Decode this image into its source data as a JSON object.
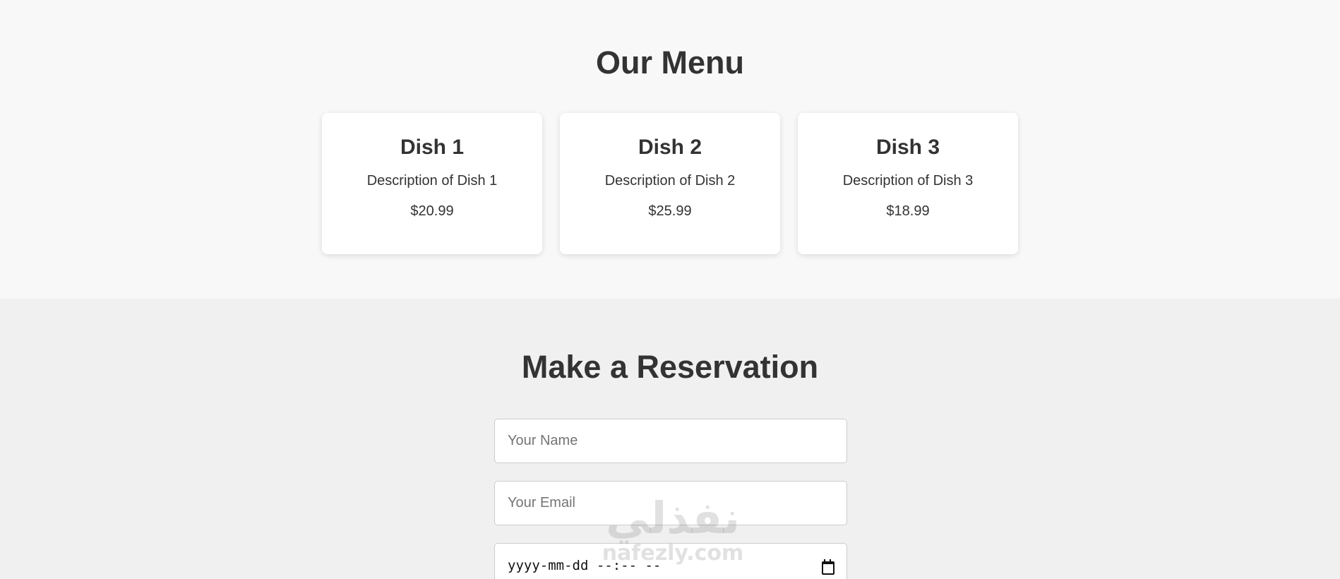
{
  "menu": {
    "title": "Our Menu",
    "dishes": [
      {
        "name": "Dish 1",
        "description": "Description of Dish 1",
        "price": "$20.99"
      },
      {
        "name": "Dish 2",
        "description": "Description of Dish 2",
        "price": "$25.99"
      },
      {
        "name": "Dish 3",
        "description": "Description of Dish 3",
        "price": "$18.99"
      }
    ]
  },
  "reservation": {
    "title": "Make a Reservation",
    "name_placeholder": "Your Name",
    "email_placeholder": "Your Email",
    "datetime_placeholder": "yyyy-mm-dd --:-- --",
    "datetime_icon": "calendar-icon"
  },
  "watermark": {
    "arabic": "نفذلي",
    "url": "nafezly.com"
  },
  "colors": {
    "menu_background": "#f8f8f8",
    "reservation_background": "#f0f0f0",
    "card_background": "#ffffff",
    "text": "#333333"
  }
}
